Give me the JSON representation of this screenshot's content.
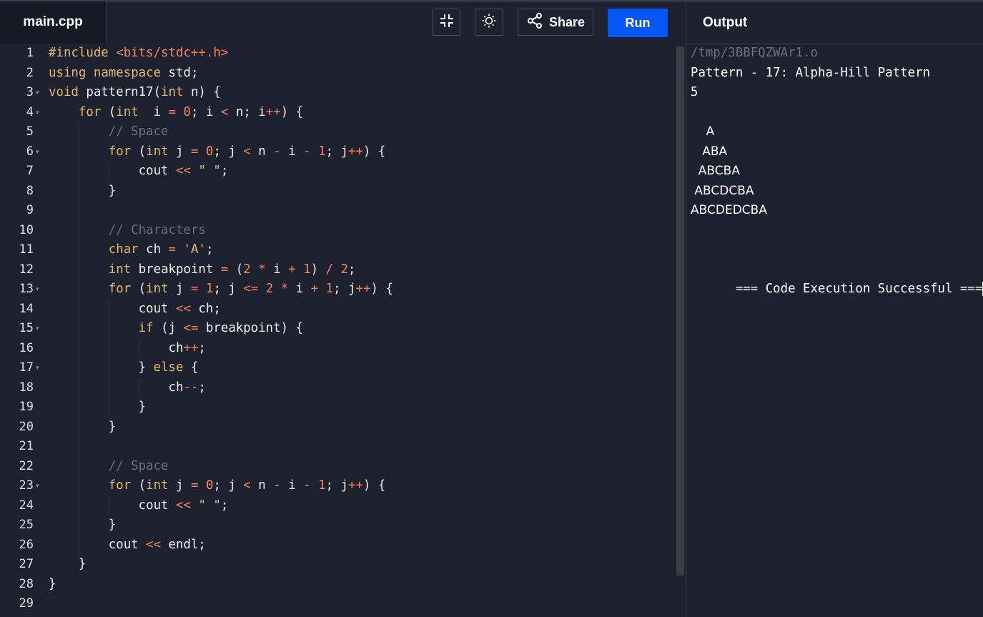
{
  "editor": {
    "file_tab": "main.cpp",
    "share_label": "Share",
    "run_label": "Run",
    "line_numbers": [
      "1",
      "2",
      "3",
      "4",
      "5",
      "6",
      "7",
      "8",
      "9",
      "10",
      "11",
      "12",
      "13",
      "14",
      "15",
      "16",
      "17",
      "18",
      "19",
      "20",
      "21",
      "22",
      "23",
      "24",
      "25",
      "26",
      "27",
      "28",
      "29"
    ],
    "code": [
      "#include <bits/stdc++.h>",
      "using namespace std;",
      "void pattern17(int n) {",
      "    for (int  i = 0; i < n; i++) {",
      "        // Space",
      "        for (int j = 0; j < n - i - 1; j++) {",
      "            cout << \" \";",
      "        }",
      "",
      "        // Characters",
      "        char ch = 'A';",
      "        int breakpoint = (2 * i + 1) / 2;",
      "        for (int j = 1; j <= 2 * i + 1; j++) {",
      "            cout << ch;",
      "            if (j <= breakpoint) {",
      "                ch++;",
      "            } else {",
      "                ch--;",
      "            }",
      "        }",
      "",
      "        // Space",
      "        for (int j = 0; j < n - i - 1; j++) {",
      "            cout << \" \";",
      "        }",
      "        cout << endl;",
      "    }",
      "}",
      ""
    ],
    "fold_lines": [
      "3",
      "4",
      "6",
      "13",
      "15",
      "17",
      "23"
    ],
    "icons": {
      "minimize": "minimize-icon",
      "theme": "sun-icon",
      "share": "share-icon"
    }
  },
  "output": {
    "title": "Output",
    "path": "/tmp/3BBFQZWAr1.o",
    "heading": "Pattern - 17: Alpha-Hill Pattern",
    "input_value": "5",
    "pattern": [
      "    A",
      "   ABA",
      "  ABCBA",
      " ABCDCBA",
      "ABCDEDCBA"
    ],
    "status": "=== Code Execution Successful ==="
  },
  "colors": {
    "background": "#1d2130",
    "run_button": "#0556f3",
    "keyword": "#e6b86a",
    "number": "#f5845c",
    "comment": "#6b7080"
  }
}
